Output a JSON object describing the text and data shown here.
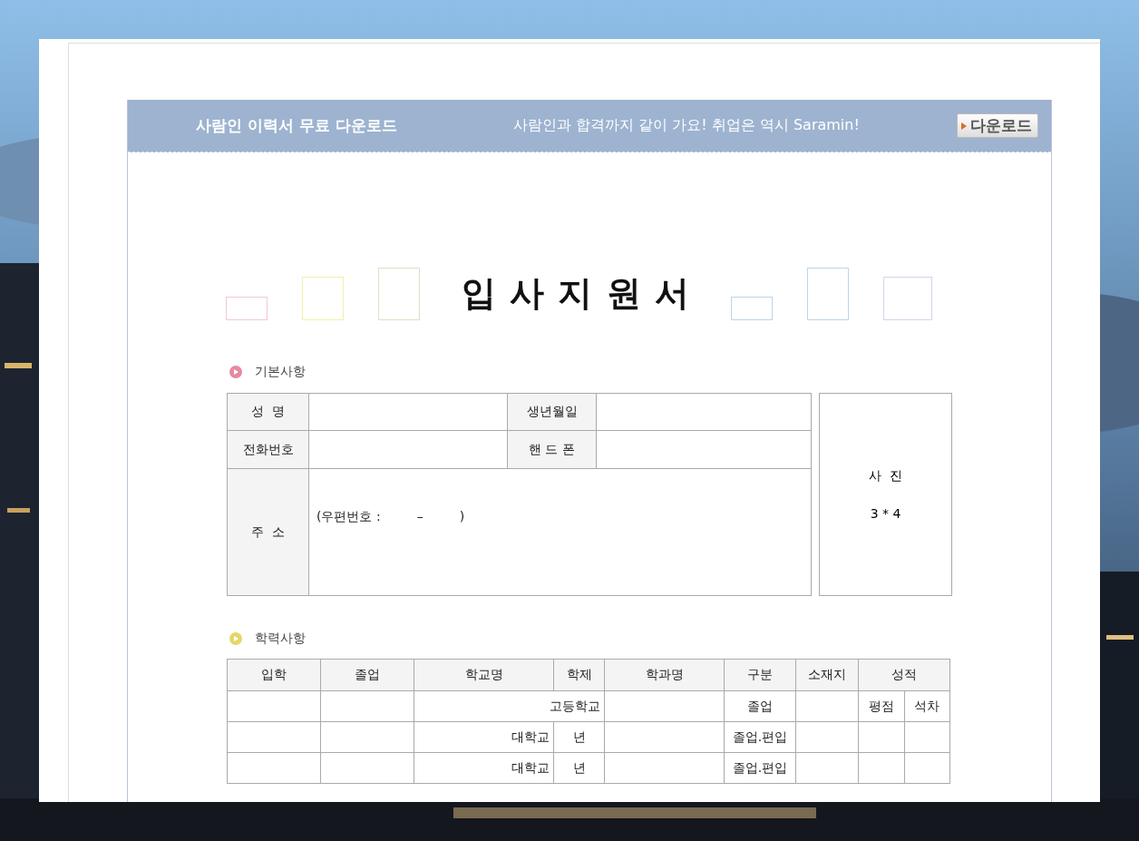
{
  "header": {
    "title": "사람인 이력서 무료 다운로드",
    "slogan": "사람인과 합격까지 같이 가요! 취업은 역시 Saramin!",
    "download_button": "다운로드"
  },
  "document": {
    "title": "입 사 지 원 서",
    "basic": {
      "heading": "기본사항",
      "color": "#e68aa0",
      "name_label": "성  명",
      "birth_label": "생년월일",
      "phone_label": "전화번호",
      "mobile_label": "핸 드 폰",
      "address_label": "주  소",
      "postcode": "(우편번호 :         –         )",
      "photo_label": "사  진",
      "photo_size": "3 * 4"
    },
    "education": {
      "heading": "학력사항",
      "color": "#e6d66a",
      "columns": [
        "입학",
        "졸업",
        "학교명",
        "학제",
        "학과명",
        "구분",
        "소재지",
        "성적"
      ],
      "grade_subheaders": [
        "평점",
        "석차"
      ],
      "rows": [
        {
          "school_and_term": "고등학교",
          "category": "졸업"
        },
        {
          "school": "대학교",
          "term": "년",
          "category": "졸업.편입"
        },
        {
          "school": "대학교",
          "term": "년",
          "category": "졸업.편입"
        }
      ]
    }
  }
}
